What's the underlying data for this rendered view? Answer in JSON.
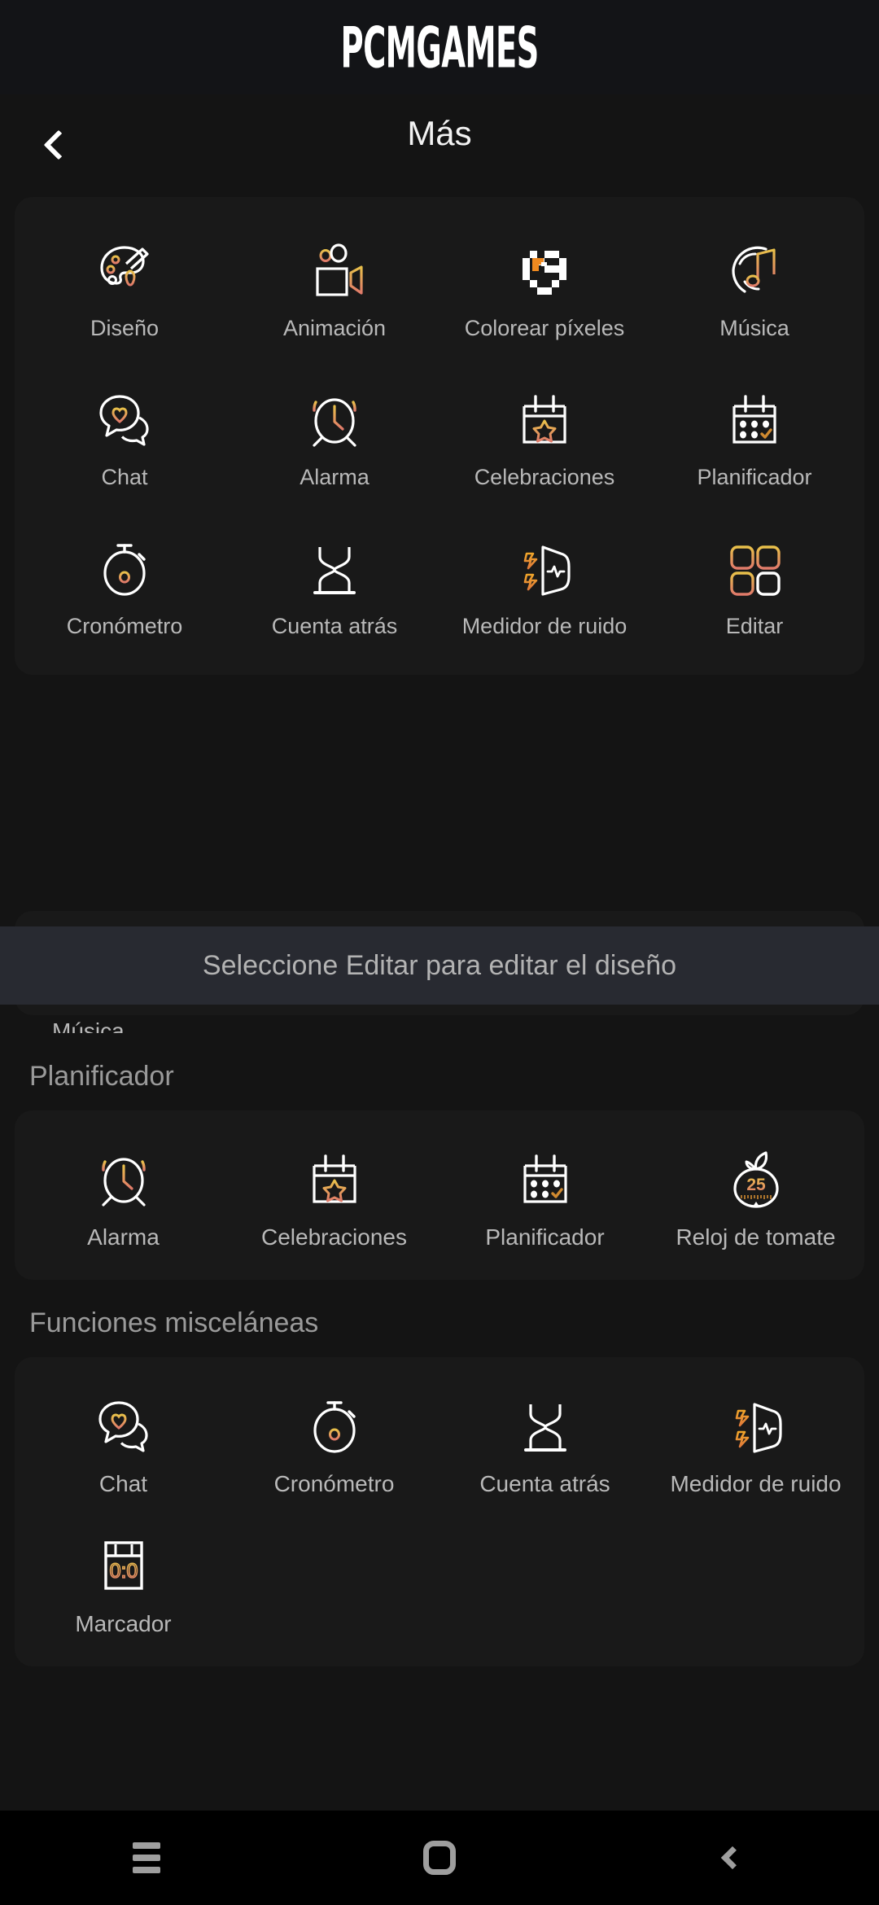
{
  "watermark": {
    "text": "PCMGAMES"
  },
  "appbar": {
    "title": "Más",
    "back_icon": "chevron-left-icon"
  },
  "colors": {
    "page_bg": "#141414",
    "card_bg": "#191919",
    "toast_bg": "#282a31",
    "label": "#b9b9b9",
    "section_label": "#9a9a9a",
    "accent_yellow": "#e8c04a",
    "accent_orange": "#e8a03a",
    "accent_salmon": "#e07a6a",
    "icon_stroke": "#ffffff"
  },
  "main_grid": {
    "rows": [
      [
        {
          "label": "Diseño",
          "icon": "palette-icon"
        },
        {
          "label": "Animación",
          "icon": "video-camera-icon"
        },
        {
          "label": "Colorear píxeles",
          "icon": "pixel-heart-icon"
        },
        {
          "label": "Música",
          "icon": "music-note-icon"
        }
      ],
      [
        {
          "label": "Chat",
          "icon": "chat-heart-icon"
        },
        {
          "label": "Alarma",
          "icon": "alarm-clock-icon"
        },
        {
          "label": "Celebraciones",
          "icon": "calendar-star-icon"
        },
        {
          "label": "Planificador",
          "icon": "calendar-check-icon"
        }
      ],
      [
        {
          "label": "Cronómetro",
          "icon": "stopwatch-icon"
        },
        {
          "label": "Cuenta atrás",
          "icon": "hourglass-icon"
        },
        {
          "label": "Medidor de ruido",
          "icon": "noise-meter-icon"
        },
        {
          "label": "Editar",
          "icon": "edit-grid-icon"
        }
      ]
    ]
  },
  "toast": {
    "message": "Seleccione Editar para editar el diseño"
  },
  "partial_section": {
    "label": "Música"
  },
  "sections": [
    {
      "title": "Planificador",
      "rows": [
        [
          {
            "label": "Alarma",
            "icon": "alarm-clock-icon"
          },
          {
            "label": "Celebraciones",
            "icon": "calendar-star-icon"
          },
          {
            "label": "Planificador",
            "icon": "calendar-check-icon"
          },
          {
            "label": "Reloj de tomate",
            "icon": "tomato-timer-icon",
            "badge": "25"
          }
        ]
      ]
    },
    {
      "title": "Funciones misceláneas",
      "rows": [
        [
          {
            "label": "Chat",
            "icon": "chat-heart-icon"
          },
          {
            "label": "Cronómetro",
            "icon": "stopwatch-icon"
          },
          {
            "label": "Cuenta atrás",
            "icon": "hourglass-icon"
          },
          {
            "label": "Medidor de ruido",
            "icon": "noise-meter-icon"
          }
        ],
        [
          {
            "label": "Marcador",
            "icon": "scoreboard-icon",
            "badge": "0:0"
          }
        ]
      ]
    }
  ],
  "navbar": {
    "recents_label": "recents-icon",
    "home_label": "home-icon",
    "back_label": "back-icon"
  }
}
